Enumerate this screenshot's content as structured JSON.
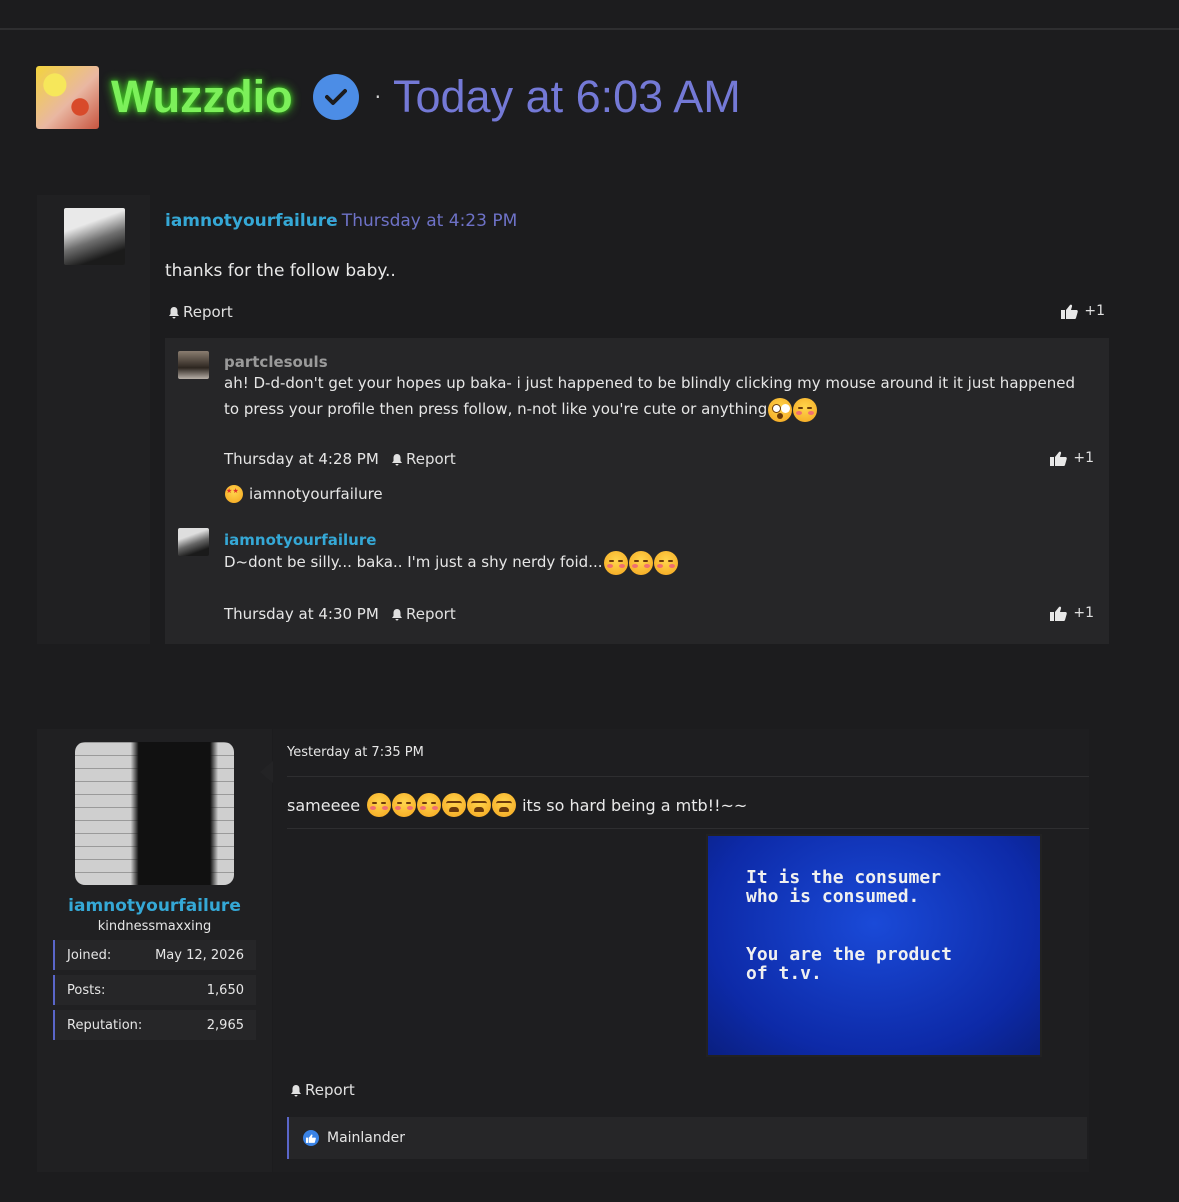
{
  "header": {
    "username": "Wuzzdio",
    "separator": "·",
    "timestamp": "Today at 6:03 AM"
  },
  "post1": {
    "username": "iamnotyourfailure",
    "meta": "· Thursday at 4:23 PM",
    "text": "thanks for the follow baby..",
    "report_label": "Report",
    "like_count": "+1",
    "replies": [
      {
        "username": "partclesouls",
        "text": "ah! D-d-don't get your hopes up baka- i just happened to be blindly clicking my mouse around it it just happened to press your profile then press follow, n-not like you're cute or anything",
        "time": "Thursday at 4:28 PM",
        "report_label": "Report",
        "like_count": "+1",
        "reaction_user": "iamnotyourfailure"
      },
      {
        "username": "iamnotyourfailure",
        "text": "D~dont be silly... baka.. I'm just a shy nerdy foid...",
        "time": "Thursday at 4:30 PM",
        "report_label": "Report",
        "like_count": "+1"
      }
    ]
  },
  "post2": {
    "author": {
      "username": "iamnotyourfailure",
      "user_title": "kindnessmaxxing",
      "stats": [
        {
          "label": "Joined:",
          "value": "May 12, 2026"
        },
        {
          "label": "Posts:",
          "value": "1,650"
        },
        {
          "label": "Reputation:",
          "value": "2,965"
        }
      ]
    },
    "time": "Yesterday at 7:35 PM",
    "text_before": "sameeee",
    "text_after": "its so hard being a mtb!!~~",
    "attachment_lines": [
      "It is the consumer",
      "who is consumed.",
      "You are the product",
      "of t.v."
    ],
    "report_label": "Report",
    "liked_by": "Mainlander"
  },
  "colors": {
    "background": "#1c1c1e",
    "accent_blue": "#35a8d6",
    "timestamp_purple": "#7479d6",
    "header_green": "#7cf05a",
    "verified_blue": "#4c8de6"
  },
  "icons": [
    "verified-check-icon",
    "bell-icon",
    "thumbs-up-icon",
    "star-struck-emoji",
    "flushed-emoji",
    "wow-emoji",
    "tired-emoji"
  ]
}
